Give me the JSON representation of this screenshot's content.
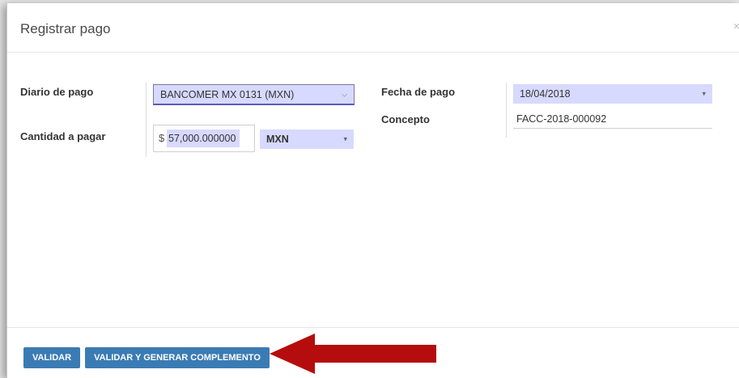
{
  "dialog": {
    "title": "Registrar pago",
    "close_glyph": "×"
  },
  "form": {
    "diario_label": "Diario de pago",
    "diario_value": "BANCOMER MX 0131 (MXN)",
    "cantidad_label": "Cantidad a pagar",
    "currency_symbol": "$",
    "amount_value": "57,000.000000",
    "currency_value": "MXN",
    "fecha_label": "Fecha de pago",
    "fecha_value": "18/04/2018",
    "concepto_label": "Concepto",
    "concepto_value": "FACC-2018-000092"
  },
  "footer": {
    "validar_label": "VALIDAR",
    "validar_generar_label": "VALIDAR Y GENERAR COMPLEMENTO"
  },
  "colors": {
    "button_bg": "#3b7bb4",
    "field_highlight": "#d8d9ff",
    "annotation_arrow": "#b50d0d"
  }
}
